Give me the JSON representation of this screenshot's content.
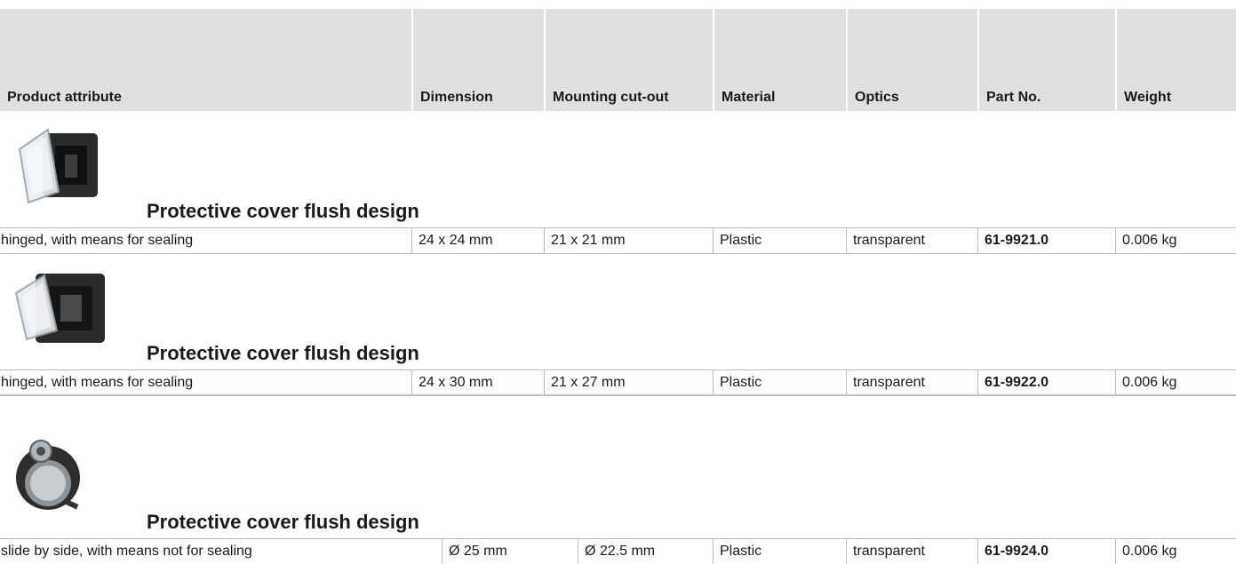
{
  "headers": [
    "Product attribute",
    "Dimension",
    "Mounting cut-out",
    "Material",
    "Optics",
    "Part No.",
    "Weight"
  ],
  "products": [
    {
      "title": "Protective cover flush design",
      "image_icon": "protective-cover-hinged-square",
      "row": [
        "hinged, with means for sealing",
        "24 x 24 mm",
        "21 x 21 mm",
        "Plastic",
        "transparent",
        "61-9921.0",
        "0.006 kg"
      ]
    },
    {
      "title": "Protective cover flush design",
      "image_icon": "protective-cover-hinged-rectangular",
      "row": [
        "hinged, with means for sealing",
        "24 x 30 mm",
        "21 x 27 mm",
        "Plastic",
        "transparent",
        "61-9922.0",
        "0.006 kg"
      ]
    },
    {
      "title": "Protective cover flush design",
      "image_icon": "protective-cover-slide-round",
      "row": [
        "slide by side, with means not for sealing",
        "Ø 25 mm",
        "Ø 22.5 mm",
        "Plastic",
        "transparent",
        "61-9924.0",
        "0.006 kg"
      ]
    }
  ]
}
